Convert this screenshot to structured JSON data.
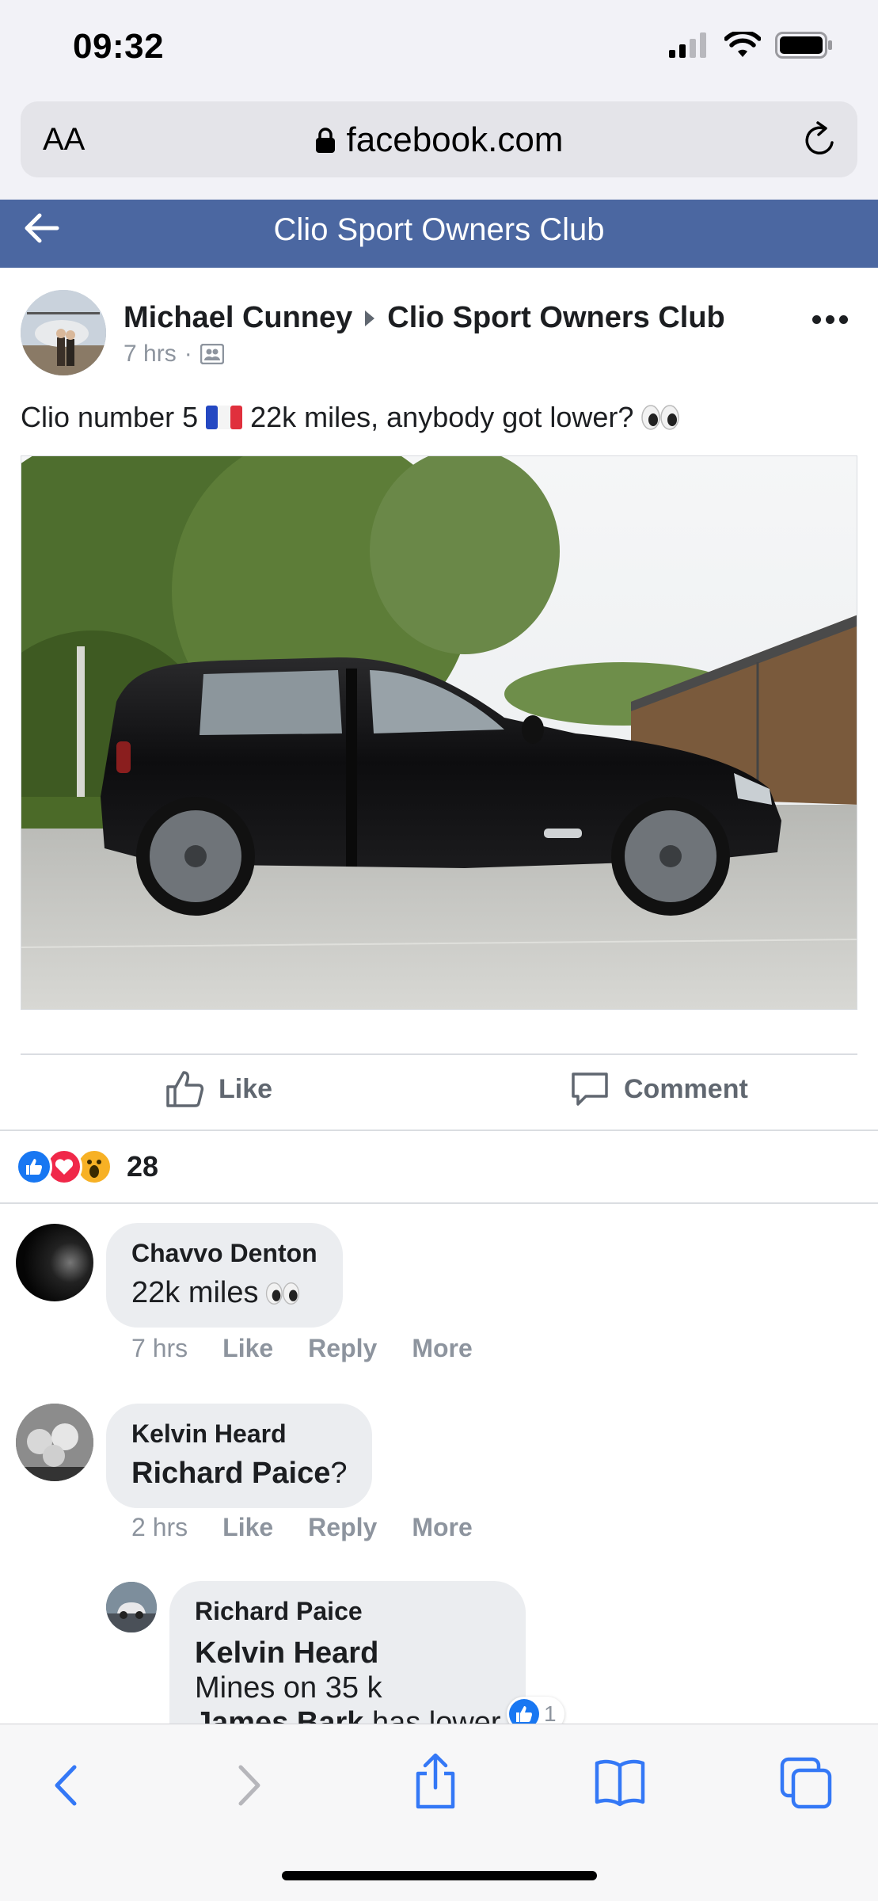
{
  "status_bar": {
    "time": "09:32"
  },
  "browser": {
    "text_size_label": "AA",
    "url": "facebook.com"
  },
  "group_header": {
    "title": "Clio Sport Owners Club"
  },
  "post": {
    "author": "Michael Cunney",
    "group": "Clio Sport Owners Club",
    "time": "7 hrs",
    "time_separator": "·",
    "text_before_flag": "Clio number 5",
    "flag_icon": "france-flag-icon",
    "text_after_flag": "22k miles, anybody got lower?",
    "eyes_icon": "eyes-emoji-icon",
    "photo_alt": "black-hatchback-car-photo"
  },
  "actions": {
    "like_label": "Like",
    "comment_label": "Comment"
  },
  "reactions": {
    "icons": [
      "like-reaction-icon",
      "love-reaction-icon",
      "wow-reaction-icon"
    ],
    "count": "28"
  },
  "comments": [
    {
      "name": "Chavvo Denton",
      "text": "22k miles",
      "time": "7 hrs",
      "like": "Like",
      "reply": "Reply",
      "more": "More"
    },
    {
      "name": "Kelvin Heard",
      "mention": "Richard Paice",
      "suffix": "?",
      "time": "2 hrs",
      "like": "Like",
      "reply": "Reply",
      "more": "More"
    }
  ],
  "reply": {
    "name": "Richard Paice",
    "mention": "Kelvin Heard",
    "line2": "Mines on 35 k",
    "line3_mention": "James Bark",
    "line3_text": " has lower",
    "like_count": "1"
  },
  "colors": {
    "facebook_blue": "#4b67a1",
    "link_blue": "#1877f2",
    "safari_blue": "#3478f6"
  }
}
